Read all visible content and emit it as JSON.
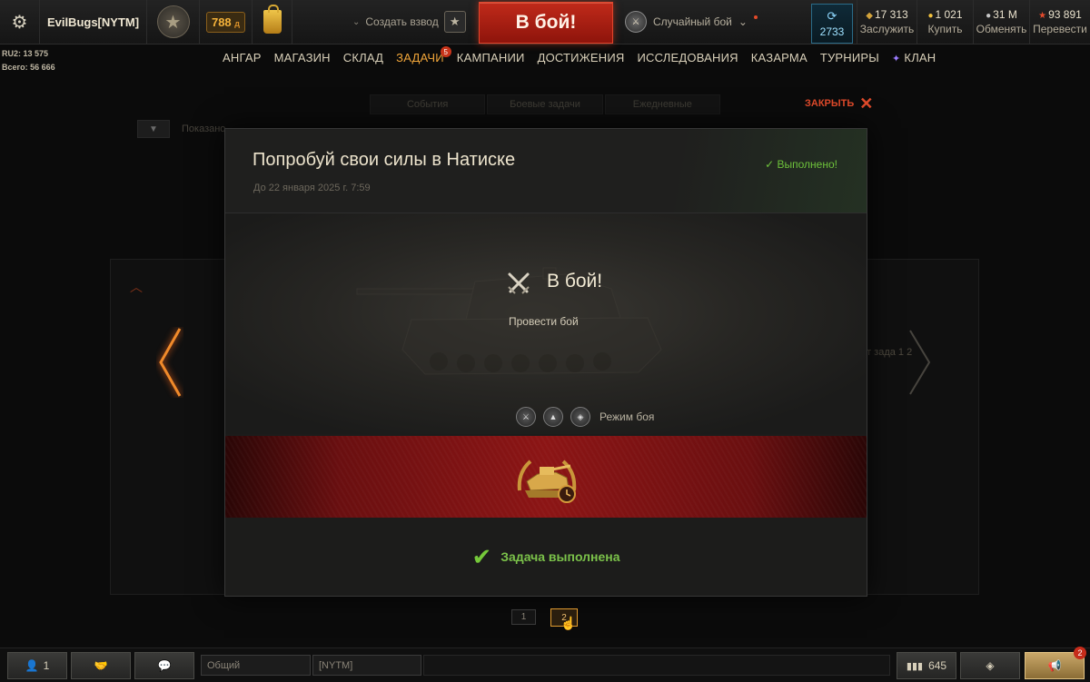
{
  "topbar": {
    "player_name": "EvilBugs[NYTM]",
    "exp_value": "788",
    "exp_unit": "д",
    "platoon_label": "Создать взвод",
    "battle_button": "В бой!",
    "battle_type": "Случайный бой",
    "free_xp": "2733",
    "currencies": [
      {
        "value": "17 313",
        "label": "Заслужить",
        "icon": "bond-icon"
      },
      {
        "value": "1 021",
        "label": "Купить",
        "icon": "gold-icon"
      },
      {
        "value": "31 M",
        "label": "Обменять",
        "icon": "silver-icon"
      },
      {
        "value": "93 891",
        "label": "Перевести",
        "icon": "free-xp-star-icon"
      }
    ]
  },
  "server": {
    "line1": "RU2: 13 575",
    "line2": "Всего: 56 666"
  },
  "menu": {
    "items": [
      "АНГАР",
      "МАГАЗИН",
      "СКЛАД",
      "ЗАДАЧИ",
      "КАМПАНИИ",
      "ДОСТИЖЕНИЯ",
      "ИССЛЕДОВАНИЯ",
      "КАЗАРМА",
      "ТУРНИРЫ",
      "КЛАН"
    ],
    "active": "ЗАДАЧИ",
    "tasks_badge": "5"
  },
  "background": {
    "tabs": [
      "События",
      "Боевые задачи",
      "Ежедневные"
    ],
    "filter_text": "Показано",
    "right_text": "нт зада  1  2"
  },
  "close_label": "ЗАКРЫТЬ",
  "modal": {
    "title": "Попробуй свои силы в Натиске",
    "deadline": "До 22 января 2025 г. 7:59",
    "status": "✓ Выполнено!",
    "condition_title": "В бой!",
    "condition_desc": "Провести бой",
    "modes_label": "Режим боя",
    "complete_text": "Задача выполнена"
  },
  "pager": {
    "pages": [
      "1",
      "2"
    ],
    "current": "2"
  },
  "bottombar": {
    "contacts_count": "1",
    "chat_channel_1": "Общий",
    "chat_channel_2": "[NYTM]",
    "session_stats": "645",
    "notifications_count": "2"
  }
}
